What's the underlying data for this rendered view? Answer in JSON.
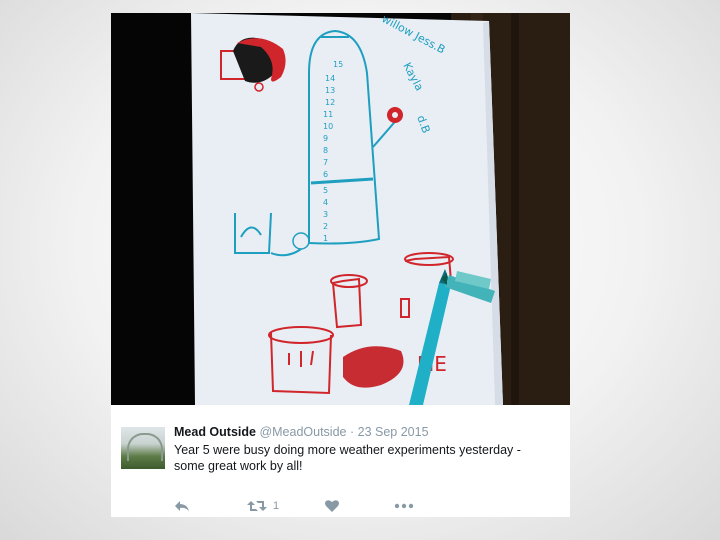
{
  "tweet": {
    "display_name": "Mead Outside",
    "handle": "@MeadOutside",
    "separator": "·",
    "date": "23 Sep 2015",
    "text": "Year 5 were busy doing more weather experiments yesterday - some great work by all!",
    "retweet_count": "1"
  },
  "photo": {
    "names_label": "willow Jess.B",
    "names_label_2": "Kayla",
    "names_label_3": "d.B",
    "me_label": "ME",
    "scale_numbers": [
      "15",
      "14",
      "13",
      "12",
      "11",
      "10",
      "9",
      "8",
      "7",
      "6",
      "5",
      "4",
      "3",
      "2",
      "1"
    ]
  },
  "icons": {
    "reply": "reply-arrow-icon",
    "retweet": "retweet-icon",
    "like": "heart-icon",
    "more": "ellipsis-icon"
  },
  "colors": {
    "name": "#14171a",
    "meta": "#8899a6",
    "drawing_blue": "#1f9fc0",
    "drawing_red": "#d0262b"
  }
}
